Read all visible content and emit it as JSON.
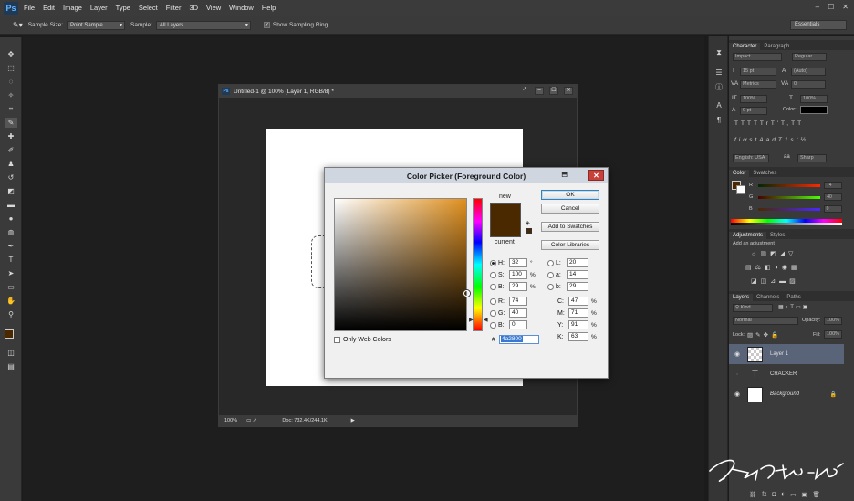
{
  "app": {
    "logo": "Ps",
    "menu": [
      "File",
      "Edit",
      "Image",
      "Layer",
      "Type",
      "Select",
      "Filter",
      "3D",
      "View",
      "Window",
      "Help"
    ],
    "window_controls": [
      "–",
      "☐",
      "✕"
    ]
  },
  "options_bar": {
    "sample_size_label": "Sample Size:",
    "sample_size_value": "Point Sample",
    "sample_label": "Sample:",
    "sample_value": "All Layers",
    "show_ring_label": "Show Sampling Ring",
    "workspace": "Essentials"
  },
  "document": {
    "title": "Untitled-1 @ 100% (Layer 1, RGB/8) *",
    "zoom": "100%",
    "doc_info": "Doc: 732.4K/244.1K"
  },
  "color_picker": {
    "title": "Color Picker (Foreground Color)",
    "new_label": "new",
    "current_label": "current",
    "ok": "OK",
    "cancel": "Cancel",
    "add_to_swatches": "Add to Swatches",
    "color_libraries": "Color Libraries",
    "only_web_colors": "Only Web Colors",
    "hex_label": "#",
    "hex_value": "4a2800",
    "fields": {
      "h": {
        "label": "H:",
        "value": "32",
        "unit": "°"
      },
      "s": {
        "label": "S:",
        "value": "100",
        "unit": "%"
      },
      "b": {
        "label": "B:",
        "value": "29",
        "unit": "%"
      },
      "r": {
        "label": "R:",
        "value": "74"
      },
      "g": {
        "label": "G:",
        "value": "40"
      },
      "bl": {
        "label": "B:",
        "value": "0"
      },
      "l": {
        "label": "L:",
        "value": "20"
      },
      "a": {
        "label": "a:",
        "value": "14"
      },
      "b2": {
        "label": "b:",
        "value": "29"
      },
      "c": {
        "label": "C:",
        "value": "47",
        "unit": "%"
      },
      "m": {
        "label": "M:",
        "value": "71",
        "unit": "%"
      },
      "y": {
        "label": "Y:",
        "value": "91",
        "unit": "%"
      },
      "k": {
        "label": "K:",
        "value": "63",
        "unit": "%"
      }
    },
    "colors": {
      "new": "#4a2800",
      "current": "#4a2800"
    }
  },
  "character_panel": {
    "tabs": [
      "Character",
      "Paragraph"
    ],
    "font_family": "Impact",
    "font_style": "Regular",
    "font_size": "15 pt",
    "leading": "(Auto)",
    "kerning": "Metrics",
    "tracking": "0",
    "vscale": "100%",
    "hscale": "100%",
    "baseline": "0 pt",
    "color_label": "Color:",
    "language": "English: USA",
    "antialias": "Sharp",
    "aa_label": "aa",
    "style_buttons": [
      "T",
      "T",
      "TT",
      "Tr",
      "T'",
      "T,",
      "T",
      "T"
    ],
    "opentype_buttons": [
      "fi",
      "ơ",
      "st",
      "A",
      "ad",
      "T",
      "1st",
      "½"
    ]
  },
  "color_panel": {
    "tabs": [
      "Color",
      "Swatches"
    ],
    "r": {
      "label": "R",
      "value": "74"
    },
    "g": {
      "label": "G",
      "value": "40"
    },
    "b": {
      "label": "B",
      "value": "0"
    }
  },
  "adjustments_panel": {
    "tabs": [
      "Adjustments",
      "Styles"
    ],
    "title": "Add an adjustment"
  },
  "layers_panel": {
    "tabs": [
      "Layers",
      "Channels",
      "Paths"
    ],
    "filter": "Kind",
    "blend_mode": "Normal",
    "opacity_label": "Opacity:",
    "opacity": "100%",
    "lock_label": "Lock:",
    "fill_label": "Fill:",
    "fill": "100%",
    "layers": [
      {
        "name": "Layer 1",
        "selected": true
      },
      {
        "name": "CRACKER",
        "type": "text"
      },
      {
        "name": "Background",
        "locked": true
      }
    ],
    "bottom_icons": [
      "⛓",
      "fx",
      "◘",
      "◐",
      "▭",
      "▣",
      "🗑"
    ]
  },
  "watermark": "Dnfoto.net"
}
